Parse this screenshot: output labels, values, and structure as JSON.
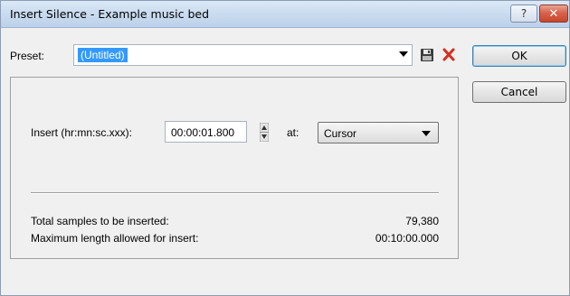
{
  "window": {
    "title": "Insert Silence - Example music bed",
    "help_glyph": "?",
    "close_glyph": "✕"
  },
  "preset": {
    "label": "Preset:",
    "value": "(Untitled)",
    "save_icon": "save-icon",
    "delete_icon": "delete-icon"
  },
  "buttons": {
    "ok": "OK",
    "cancel": "Cancel"
  },
  "insert": {
    "label": "Insert (hr:mn:sc.xxx):",
    "value": "00:00:01.800",
    "at_label": "at:",
    "at_value": "Cursor"
  },
  "info": {
    "total_label": "Total samples to be inserted:",
    "total_value": "79,380",
    "max_label": "Maximum length allowed for insert:",
    "max_value": "00:10:00.000"
  },
  "colors": {
    "selection": "#3399ff",
    "delete_red": "#d33020",
    "title_gradient_top": "#dce8f6",
    "close_red": "#c8452b"
  }
}
